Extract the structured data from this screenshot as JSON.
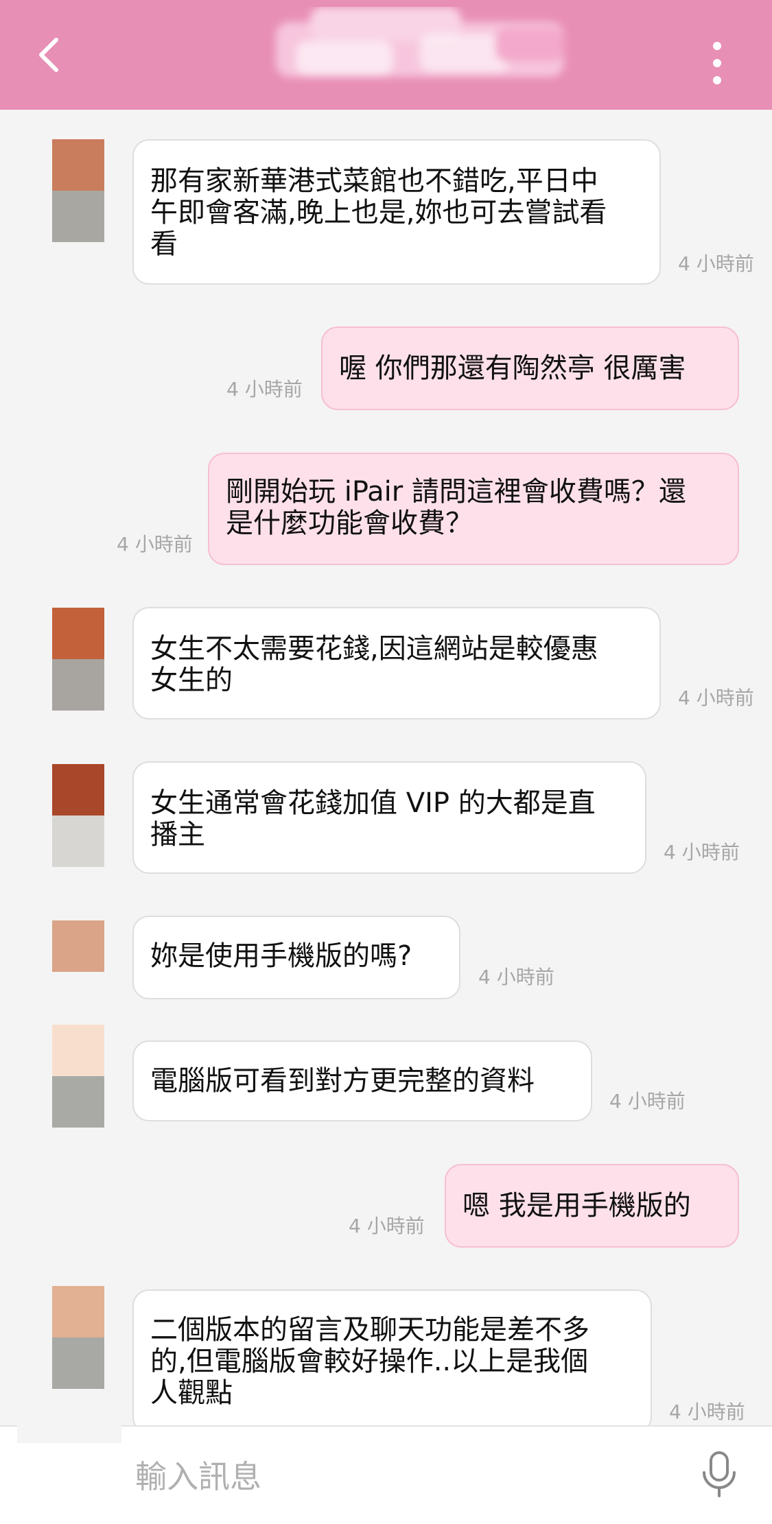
{
  "header": {
    "back_icon": "chevron-left-icon",
    "menu_icon": "more-vertical-icon",
    "background": "#e88fb5"
  },
  "messages": [
    {
      "side": "in",
      "text": "那有家新華港式菜館也不錯吃,平日中\n午即會客滿,晚上也是,妳也可去嘗試看\n看",
      "time": "4 小時前"
    },
    {
      "side": "out",
      "text": "喔 你們那還有陶然亭 很厲害",
      "time": "4 小時前"
    },
    {
      "side": "out",
      "text": "剛開始玩 iPair 請問這裡會收費嗎？還\n是什麼功能會收費？",
      "time": "4 小時前"
    },
    {
      "side": "in",
      "text": "女生不太需要花錢,因這網站是較優惠\n女生的",
      "time": "4 小時前"
    },
    {
      "side": "in",
      "text": "女生通常會花錢加值 VIP 的大都是直\n播主",
      "time": "4 小時前"
    },
    {
      "side": "in",
      "text": "妳是使用手機版的嗎?",
      "time": "4 小時前"
    },
    {
      "side": "in",
      "text": "電腦版可看到對方更完整的資料",
      "time": "4 小時前"
    },
    {
      "side": "out",
      "text": "嗯 我是用手機版的",
      "time": "4 小時前"
    },
    {
      "side": "in",
      "text": "二個版本的留言及聊天功能是差不多\n的,但電腦版會較好操作..以上是我個\n人觀點",
      "time": "4 小時前"
    }
  ],
  "avatars": [
    {
      "top": "#c97d5c",
      "bottom": "#a8a7a2"
    },
    {
      "top": "#c2613a",
      "bottom": "#a8a4a0"
    },
    {
      "top": "#a9472a",
      "bottom": "#d8d6d3"
    },
    {
      "top": "#d9a487",
      "bottom": ""
    },
    {
      "top": "#f8dfcd",
      "bottom": "#a9aaa6"
    },
    {
      "top": "#e2b092",
      "bottom": "#a8a8a4"
    }
  ],
  "input": {
    "placeholder": "輸入訊息",
    "mic_icon": "microphone-icon"
  },
  "colors": {
    "incoming_bubble": "#ffffff",
    "outgoing_bubble": "#fde0ea",
    "timestamp": "#a6a6a6"
  }
}
